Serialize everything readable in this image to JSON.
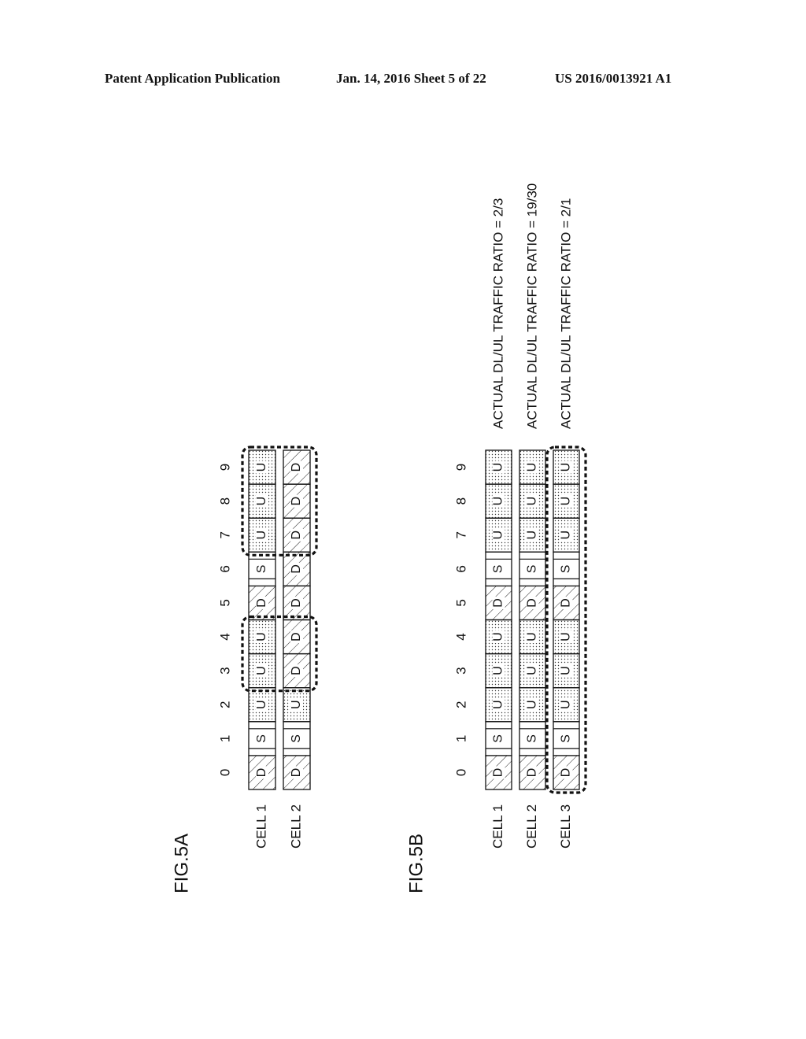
{
  "header": {
    "left": "Patent Application Publication",
    "middle": "Jan. 14, 2016  Sheet 5 of 22",
    "right": "US 2016/0013921 A1"
  },
  "legend": {
    "D": "downlink subframe (hatched)",
    "U": "uplink subframe (dotted)",
    "S": "special subframe (blank)"
  },
  "figures": [
    {
      "id": "fig5a",
      "label": "FIG.5A",
      "subframe_indices": [
        "0",
        "1",
        "2",
        "3",
        "4",
        "5",
        "6",
        "7",
        "8",
        "9"
      ],
      "cells": [
        {
          "name": "CELL 1",
          "subframes": [
            "D",
            "S",
            "U",
            "U",
            "U",
            "D",
            "S",
            "U",
            "U",
            "U"
          ]
        },
        {
          "name": "CELL 2",
          "subframes": [
            "D",
            "S",
            "U",
            "D",
            "D",
            "D",
            "D",
            "D",
            "D",
            "D"
          ]
        }
      ],
      "highlights": [
        {
          "cells": [
            0,
            1
          ],
          "from": 3,
          "to": 4
        },
        {
          "cells": [
            0,
            1
          ],
          "from": 7,
          "to": 9
        }
      ],
      "ratios": []
    },
    {
      "id": "fig5b",
      "label": "FIG.5B",
      "subframe_indices": [
        "0",
        "1",
        "2",
        "3",
        "4",
        "5",
        "6",
        "7",
        "8",
        "9"
      ],
      "cells": [
        {
          "name": "CELL 1",
          "subframes": [
            "D",
            "S",
            "U",
            "U",
            "U",
            "D",
            "S",
            "U",
            "U",
            "U"
          ]
        },
        {
          "name": "CELL 2",
          "subframes": [
            "D",
            "S",
            "U",
            "U",
            "U",
            "D",
            "S",
            "U",
            "U",
            "U"
          ]
        },
        {
          "name": "CELL 3",
          "subframes": [
            "D",
            "S",
            "U",
            "U",
            "U",
            "D",
            "S",
            "U",
            "U",
            "U"
          ]
        }
      ],
      "highlights": [
        {
          "cells": [
            2
          ],
          "from": 0,
          "to": 9
        }
      ],
      "ratios": [
        "ACTUAL DL/UL TRAFFIC RATIO = 2/3",
        "ACTUAL DL/UL TRAFFIC RATIO = 19/30",
        "ACTUAL DL/UL TRAFFIC RATIO = 2/1"
      ]
    }
  ]
}
